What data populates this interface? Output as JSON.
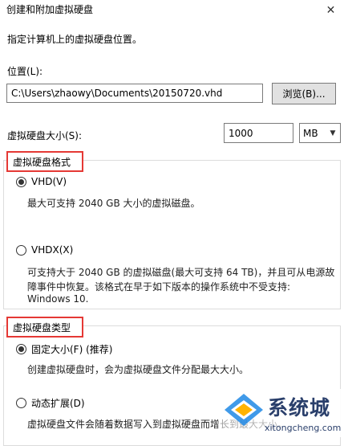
{
  "window": {
    "title": "创建和附加虚拟硬盘"
  },
  "instruction": "指定计算机上的虚拟硬盘位置。",
  "location": {
    "label": "位置(L):",
    "value": "C:\\Users\\zhaowy\\Documents\\20150720.vhd",
    "browse_label": "浏览(B)..."
  },
  "size": {
    "label": "虚拟硬盘大小(S):",
    "value": "1000",
    "unit": "MB"
  },
  "format_section": {
    "title": "虚拟硬盘格式",
    "options": [
      {
        "label": "VHD(V)",
        "selected": true,
        "desc": [
          "最大可支持 2040 GB 大小的虚拟磁盘。"
        ]
      },
      {
        "label": "VHDX(X)",
        "selected": false,
        "desc": [
          "可支持大于 2040 GB 的虚拟磁盘(最大可支持 64 TB)，并且可从电源故",
          "障事件中恢复。该格式在早于如下版本的操作系统中不受支持:",
          "Windows 10."
        ]
      }
    ]
  },
  "type_section": {
    "title": "虚拟硬盘类型",
    "options": [
      {
        "label": "固定大小(F) (推荐)",
        "selected": true,
        "desc": [
          "创建虚拟硬盘时，会为虚拟硬盘文件分配最大大小。"
        ]
      },
      {
        "label": "动态扩展(D)",
        "selected": false,
        "desc": [
          "虚拟硬盘文件会随着数据写入到虚拟硬盘而增长到最大大小。"
        ]
      }
    ]
  },
  "watermark": {
    "title": "系统城",
    "url": "xitongcheng.com"
  },
  "colors": {
    "highlight_border": "#e53935",
    "watermark": "#2a3f6b"
  }
}
